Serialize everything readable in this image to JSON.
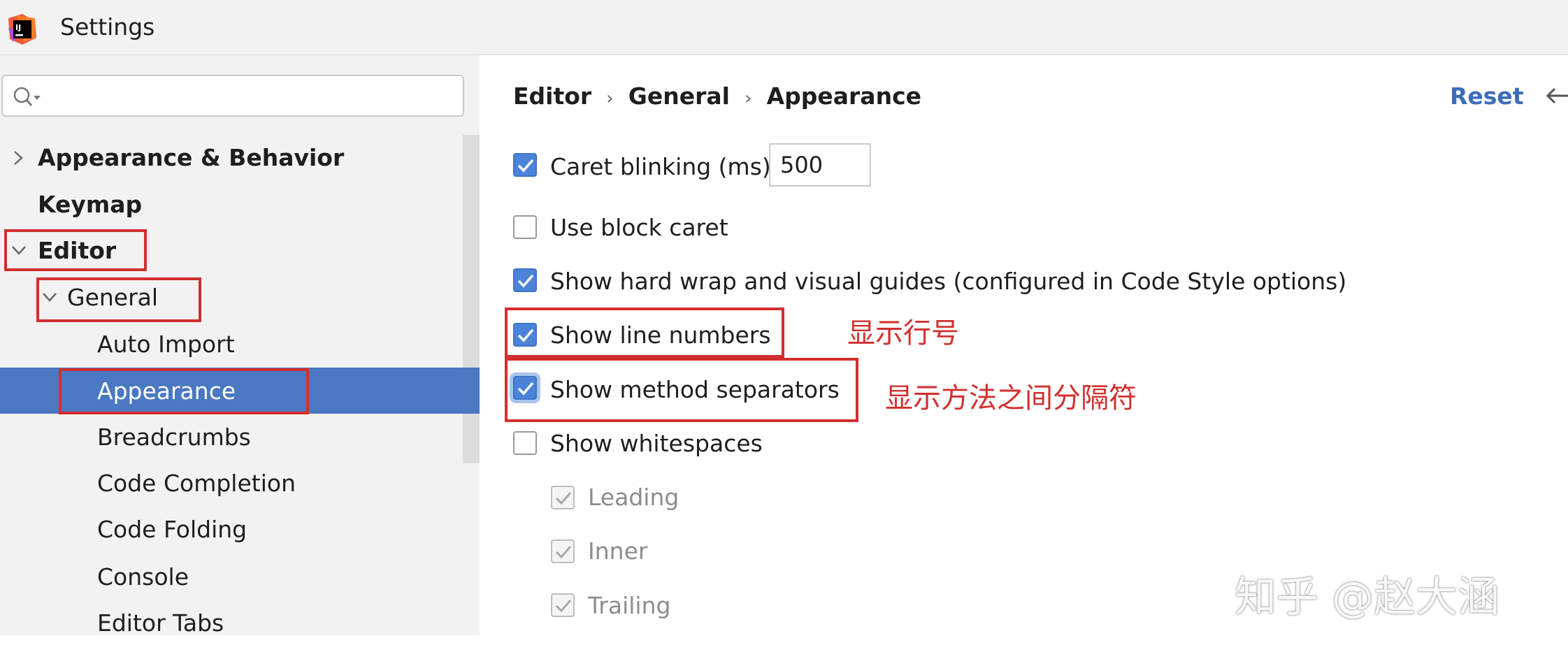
{
  "window": {
    "title": "Settings"
  },
  "search": {
    "placeholder": ""
  },
  "tree": {
    "appearance_behavior": "Appearance & Behavior",
    "keymap": "Keymap",
    "editor": "Editor",
    "general": "General",
    "auto_import": "Auto Import",
    "appearance": "Appearance",
    "breadcrumbs": "Breadcrumbs",
    "code_completion": "Code Completion",
    "code_folding": "Code Folding",
    "console": "Console",
    "editor_tabs": "Editor Tabs"
  },
  "breadcrumb": {
    "items": [
      "Editor",
      "General",
      "Appearance"
    ],
    "separator": "›"
  },
  "header": {
    "reset_label": "Reset"
  },
  "options": {
    "caret_blinking": {
      "label": "Caret blinking (ms):",
      "checked": true,
      "value": "500"
    },
    "use_block_caret": {
      "label": "Use block caret",
      "checked": false
    },
    "hard_wrap": {
      "label": "Show hard wrap and visual guides (configured in Code Style options)",
      "checked": true
    },
    "line_numbers": {
      "label": "Show line numbers",
      "checked": true
    },
    "method_separators": {
      "label": "Show method separators",
      "checked": true
    },
    "whitespaces": {
      "label": "Show whitespaces",
      "checked": false
    },
    "leading": {
      "label": "Leading",
      "checked": true,
      "disabled": true
    },
    "inner": {
      "label": "Inner",
      "checked": true,
      "disabled": true
    },
    "trailing": {
      "label": "Trailing",
      "checked": true,
      "disabled": true
    }
  },
  "annotations": {
    "line_numbers_note": "显示行号",
    "separators_note": "显示方法之间分隔符"
  },
  "watermark": "知乎 @赵大涵",
  "colors": {
    "accent": "#4a78c2",
    "annotation": "#d32f2f",
    "link": "#3d6cb9"
  }
}
